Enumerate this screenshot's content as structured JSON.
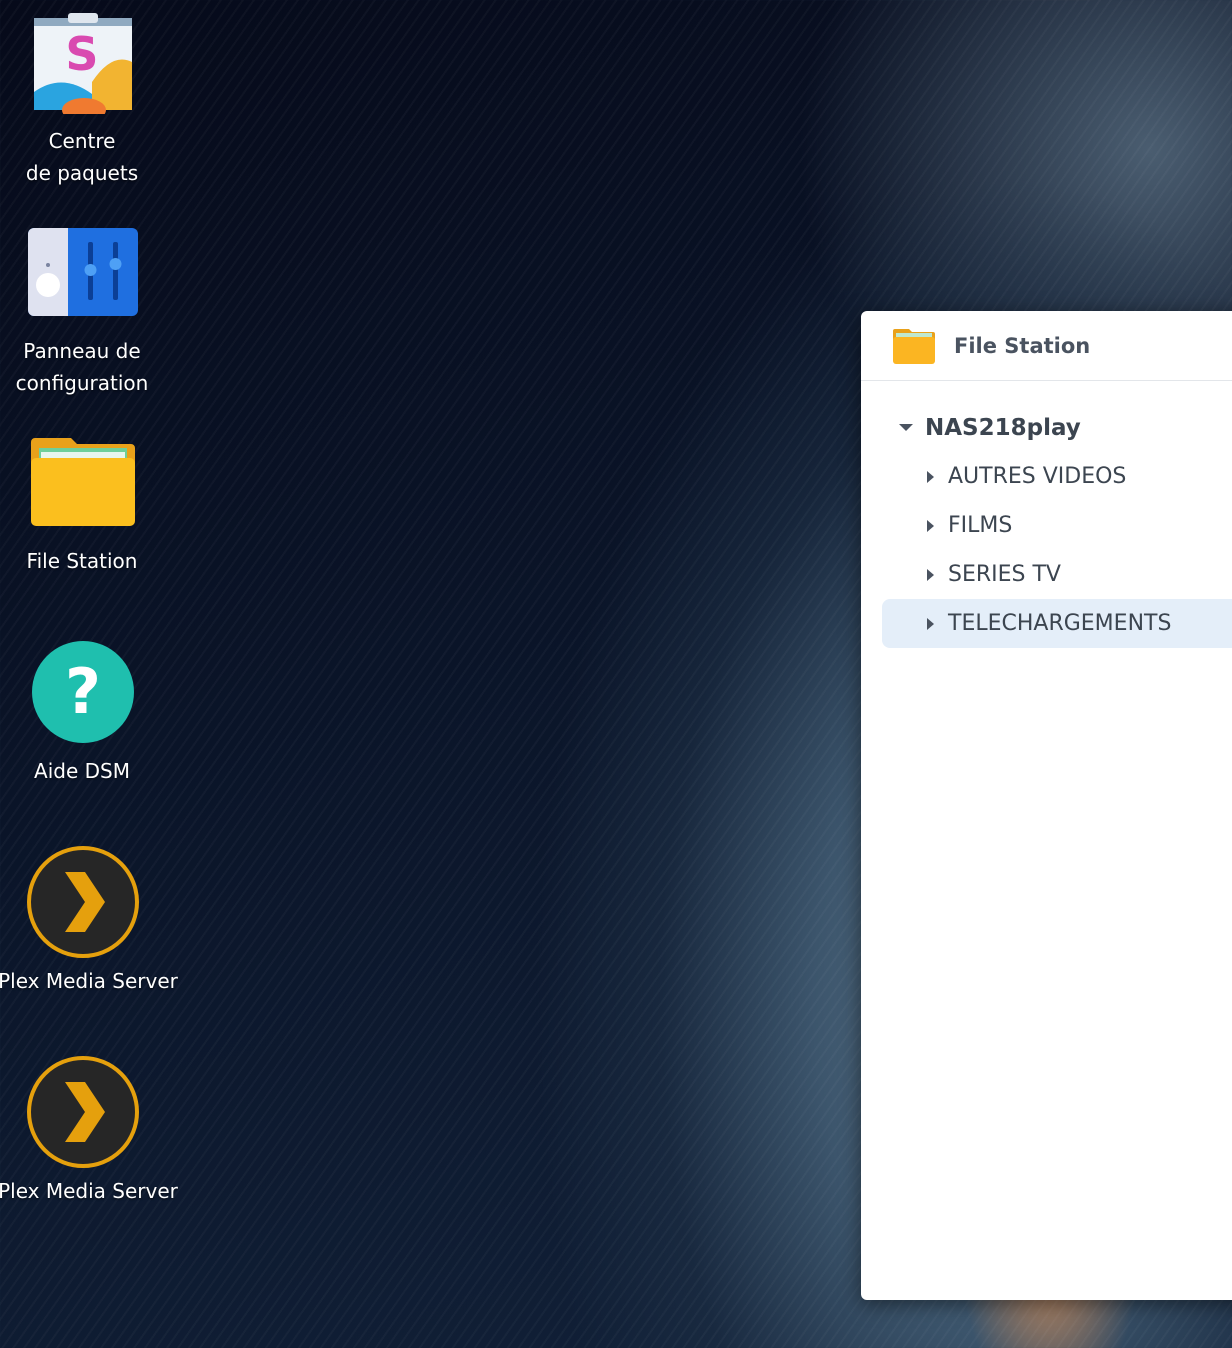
{
  "desktop": {
    "icons": [
      {
        "label_lines": [
          "Centre",
          "de paquets"
        ],
        "icon": "package-center-icon"
      },
      {
        "label_lines": [
          "Panneau de",
          "configuration"
        ],
        "icon": "control-panel-icon"
      },
      {
        "label_lines": [
          "File Station"
        ],
        "icon": "file-station-icon"
      },
      {
        "label_lines": [
          "Aide DSM"
        ],
        "icon": "help-icon"
      },
      {
        "label_lines": [
          "Plex Media Server"
        ],
        "icon": "plex-icon"
      },
      {
        "label_lines": [
          "Plex Media Server"
        ],
        "icon": "plex-icon"
      }
    ]
  },
  "window": {
    "title": "File Station",
    "tree": {
      "root": "NAS218play",
      "children": [
        "AUTRES VIDEOS",
        "FILMS",
        "SERIES TV",
        "TELECHARGEMENTS"
      ],
      "selected": "TELECHARGEMENTS"
    }
  },
  "colors": {
    "selected_bg": "#e4eef9",
    "text": "#3c4550"
  }
}
